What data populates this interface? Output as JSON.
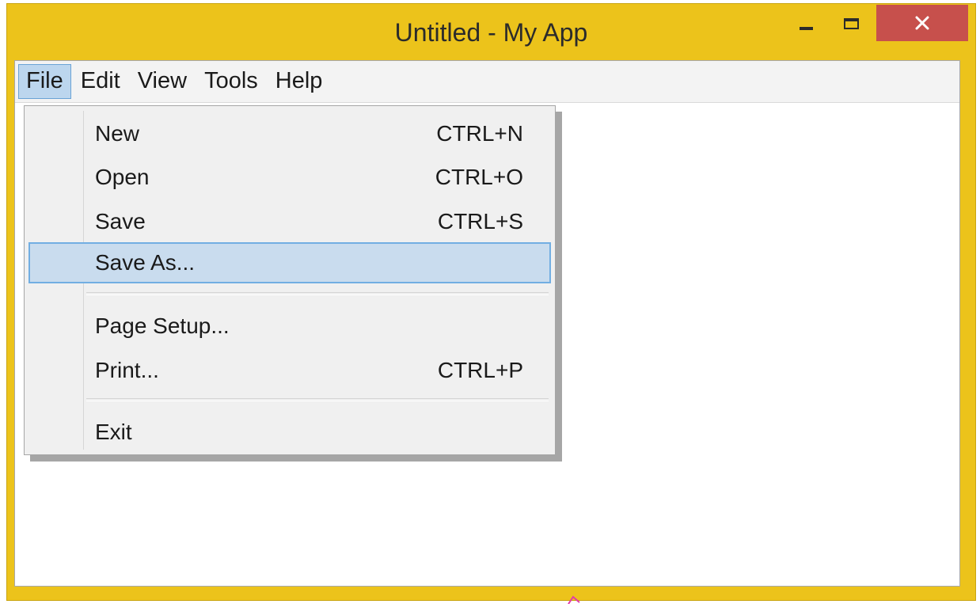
{
  "window": {
    "title": "Untitled - My App",
    "colors": {
      "frame": "#ecc31b",
      "close": "#c7504c",
      "highlight": "#c9dcee"
    },
    "controls": {
      "minimize_icon": "minimize-icon",
      "maximize_icon": "maximize-icon",
      "close_icon": "close-icon"
    }
  },
  "menubar": {
    "items": [
      {
        "label": "File",
        "active": true
      },
      {
        "label": "Edit"
      },
      {
        "label": "View"
      },
      {
        "label": "Tools"
      },
      {
        "label": "Help"
      }
    ]
  },
  "file_menu": {
    "items": [
      {
        "label": "New",
        "shortcut": "CTRL+N"
      },
      {
        "label": "Open",
        "shortcut": "CTRL+O"
      },
      {
        "label": "Save",
        "shortcut": "CTRL+S"
      },
      {
        "label": "Save As...",
        "shortcut": "",
        "highlighted": true
      },
      {
        "label": "Page Setup...",
        "shortcut": ""
      },
      {
        "label": "Print...",
        "shortcut": "CTRL+P"
      },
      {
        "label": "Exit",
        "shortcut": ""
      }
    ]
  }
}
